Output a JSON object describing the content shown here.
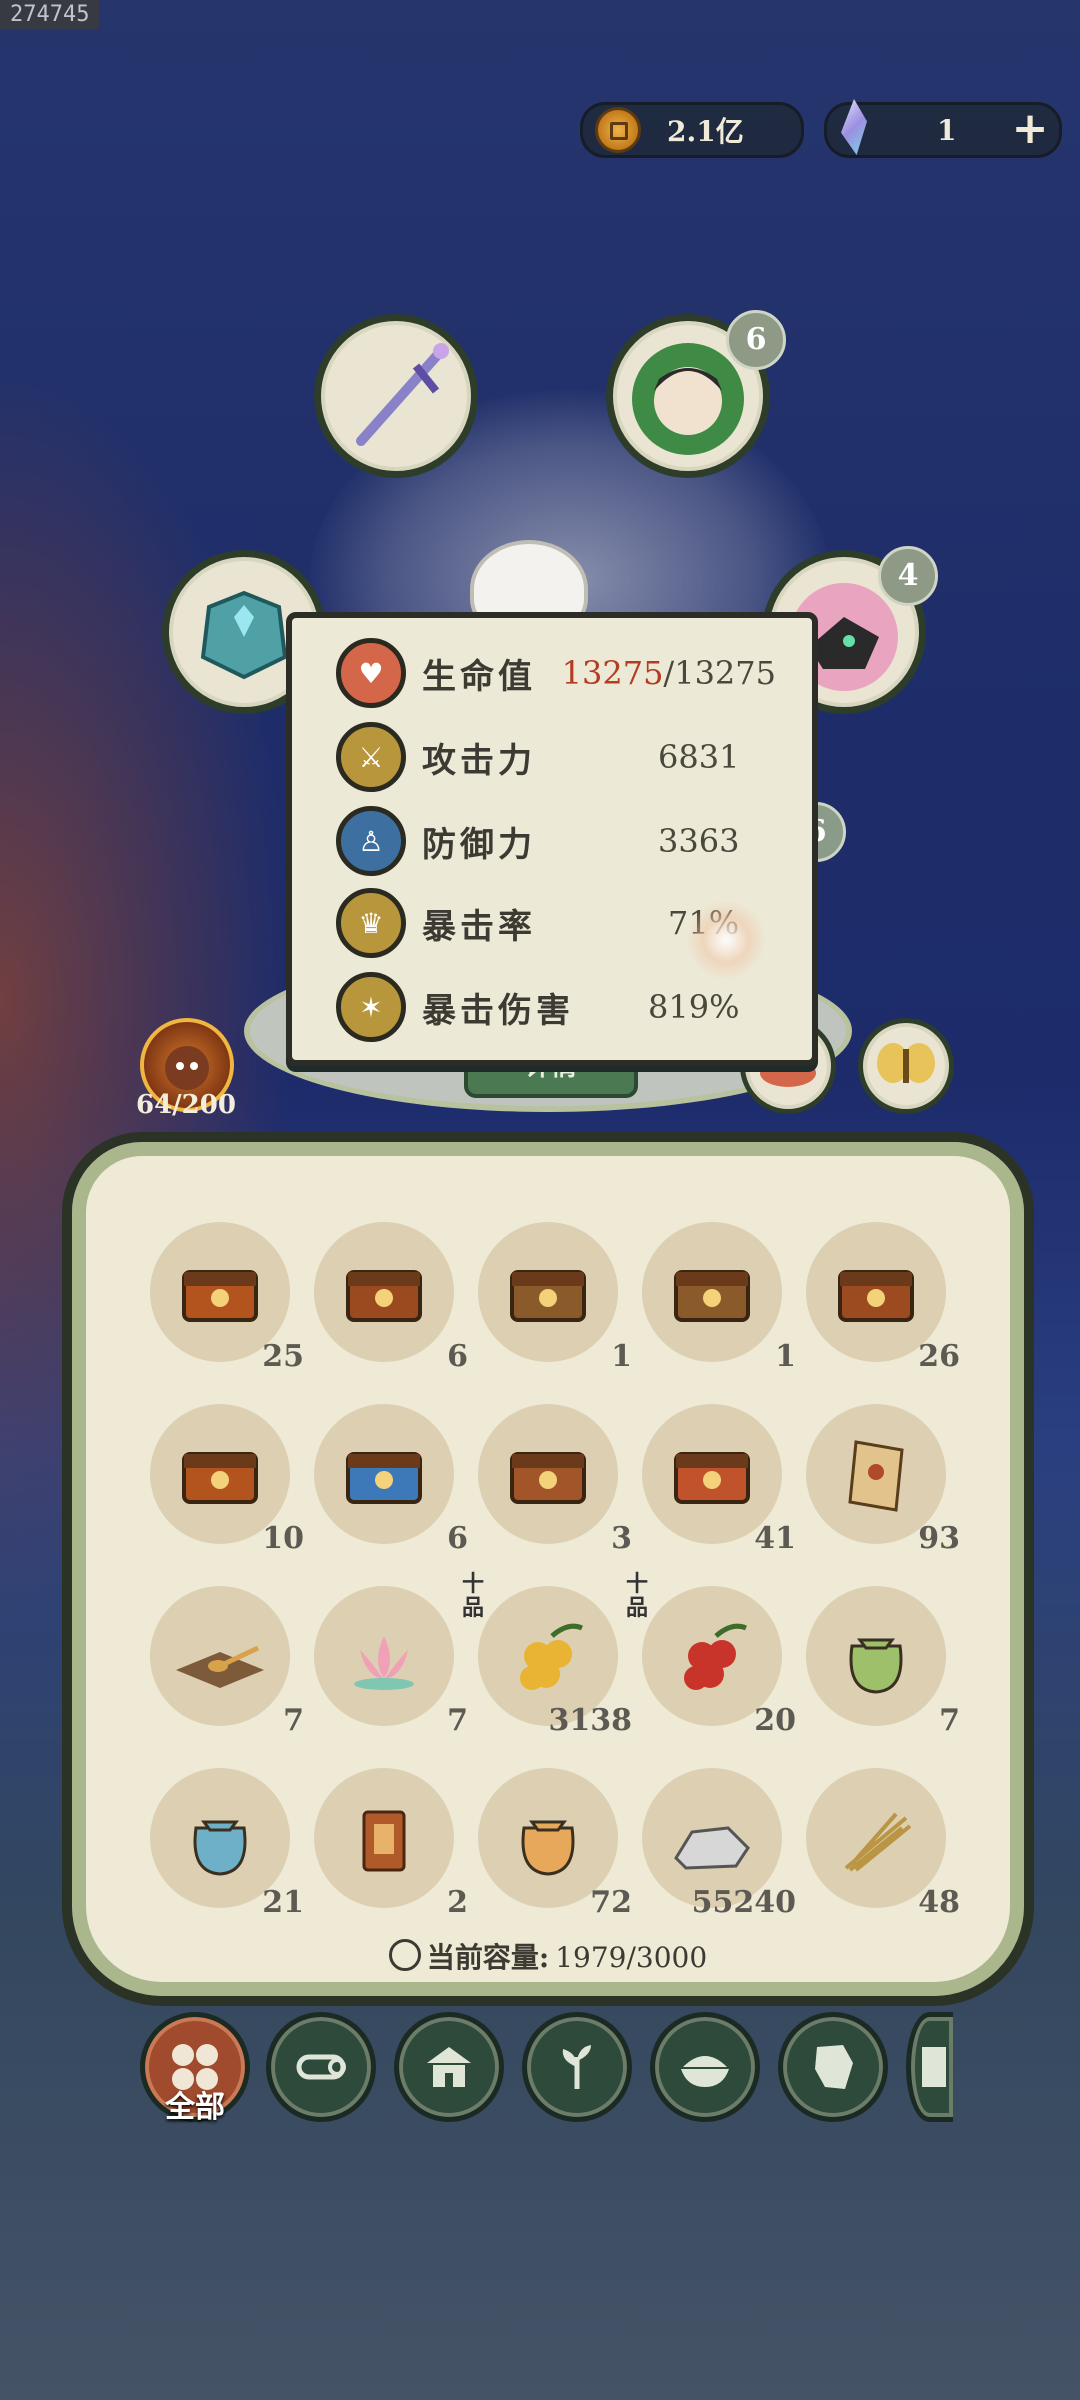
{
  "debug_id": "274745",
  "currency": {
    "coins": "2.1亿",
    "crystals": "1"
  },
  "equipment": {
    "slot_badges": {
      "character": "6",
      "pet": "4",
      "third": "6"
    },
    "monster_level": "64/200",
    "detail_button": "详情"
  },
  "stats": {
    "hp": {
      "label": "生命值",
      "current": "13275",
      "max": "/13275"
    },
    "attack": {
      "label": "攻击力",
      "value": "6831"
    },
    "defense": {
      "label": "防御力",
      "value": "3363"
    },
    "crit_rate": {
      "label": "暴击率",
      "value": "71%"
    },
    "crit_damage": {
      "label": "暴击伤害",
      "value": "819%"
    }
  },
  "inventory": {
    "items": [
      {
        "icon": "chest-gold-icon",
        "qty": "25"
      },
      {
        "icon": "chest-scroll-icon",
        "qty": "6"
      },
      {
        "icon": "chest-wood-icon",
        "qty": "1"
      },
      {
        "icon": "chest-wood-icon",
        "qty": "1"
      },
      {
        "icon": "chest-jade-icon",
        "qty": "26"
      },
      {
        "icon": "chest-gold-icon",
        "qty": "10"
      },
      {
        "icon": "chest-blue-icon",
        "qty": "6"
      },
      {
        "icon": "chest-gourd-icon",
        "qty": "3"
      },
      {
        "icon": "chest-star-icon",
        "qty": "41"
      },
      {
        "icon": "map-scroll-icon",
        "qty": "93"
      },
      {
        "icon": "spoon-plate-icon",
        "qty": "7"
      },
      {
        "icon": "lotus-icon",
        "qty": "7"
      },
      {
        "icon": "yellow-berry-icon",
        "qty": "3138",
        "tag": "十品"
      },
      {
        "icon": "red-berry-icon",
        "qty": "20",
        "tag": "十品"
      },
      {
        "icon": "green-pouch-icon",
        "qty": "7"
      },
      {
        "icon": "fish-pouch-icon",
        "qty": "21"
      },
      {
        "icon": "token-icon",
        "qty": "2"
      },
      {
        "icon": "face-pouch-icon",
        "qty": "72"
      },
      {
        "icon": "stone-icon",
        "qty": "55240"
      },
      {
        "icon": "straw-icon",
        "qty": "48"
      }
    ],
    "capacity_label": "当前容量:",
    "capacity_value": "1979/3000"
  },
  "tabs": {
    "all_label": "全部"
  },
  "colors": {
    "accent": "#b43c22",
    "panel_border": "#aab68c",
    "tab_active": "#a14b2e",
    "tab": "#2e4a3b"
  }
}
